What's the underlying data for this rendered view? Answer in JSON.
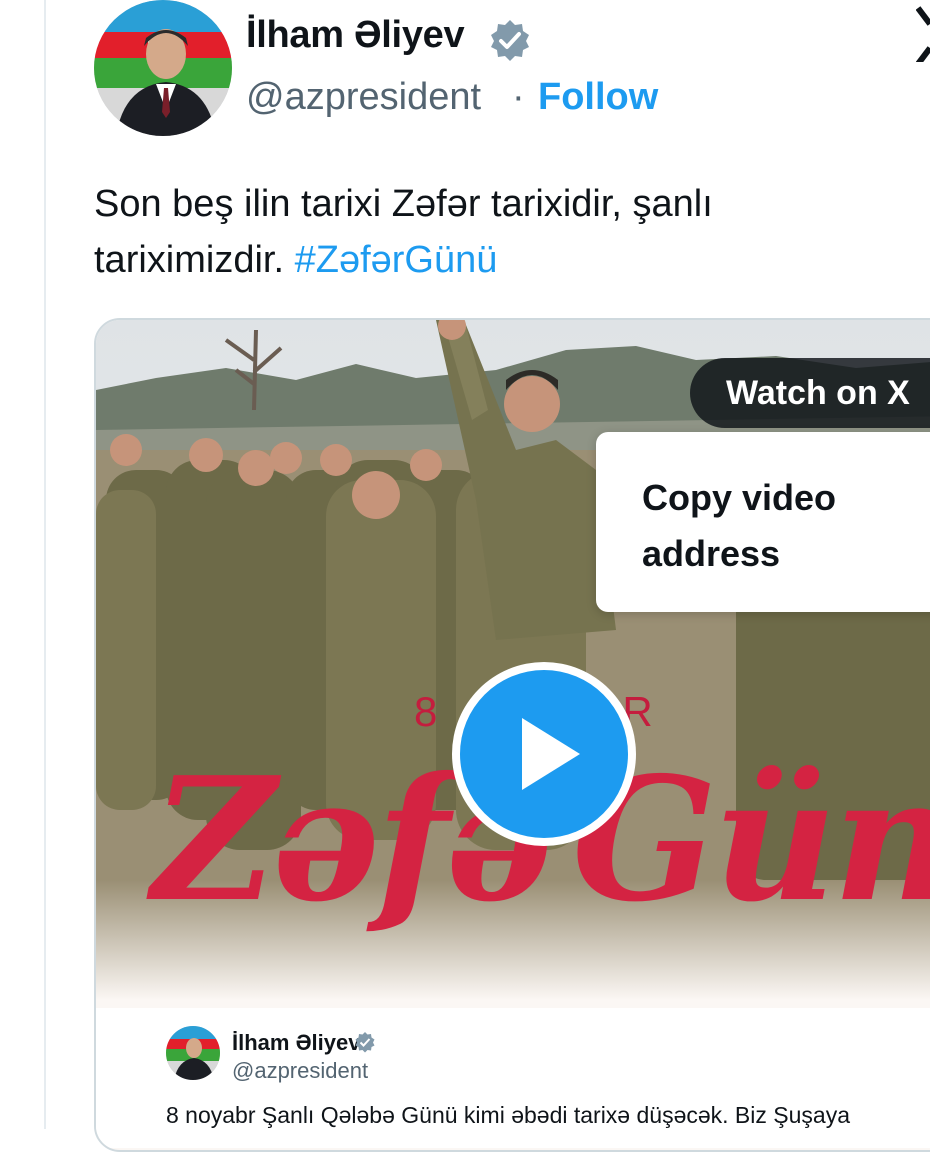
{
  "author": {
    "name": "İlham Əliyev",
    "handle": "@azpresident",
    "separator": "·",
    "follow_label": "Follow",
    "verified": true
  },
  "tweet": {
    "text_before": "Son beş ilin tarixi Zəfər tarixidir, şanlı tariximizdir.",
    "hashtag": "#ZəfərGünü"
  },
  "media": {
    "type": "video",
    "watch_label": "Watch on X",
    "context_menu": [
      "Copy video address"
    ],
    "overlay_date": "8",
    "overlay_date_tail": "RR",
    "overlay_title_left": "Zəfə",
    "overlay_title_right": "Günü",
    "embedded_tweet": {
      "name": "İlham Əliyev",
      "handle": "@azpresident",
      "text": "8 noyabr Şanlı Qələbə Günü kimi əbədi tarixə düşəcək. Biz Şuşaya"
    }
  },
  "colors": {
    "accent": "#1d9bf0",
    "title_red": "#d42342",
    "text_primary": "#0f1419",
    "text_secondary": "#536471"
  },
  "icons": [
    "verified-badge-icon",
    "close-icon",
    "play-icon"
  ]
}
